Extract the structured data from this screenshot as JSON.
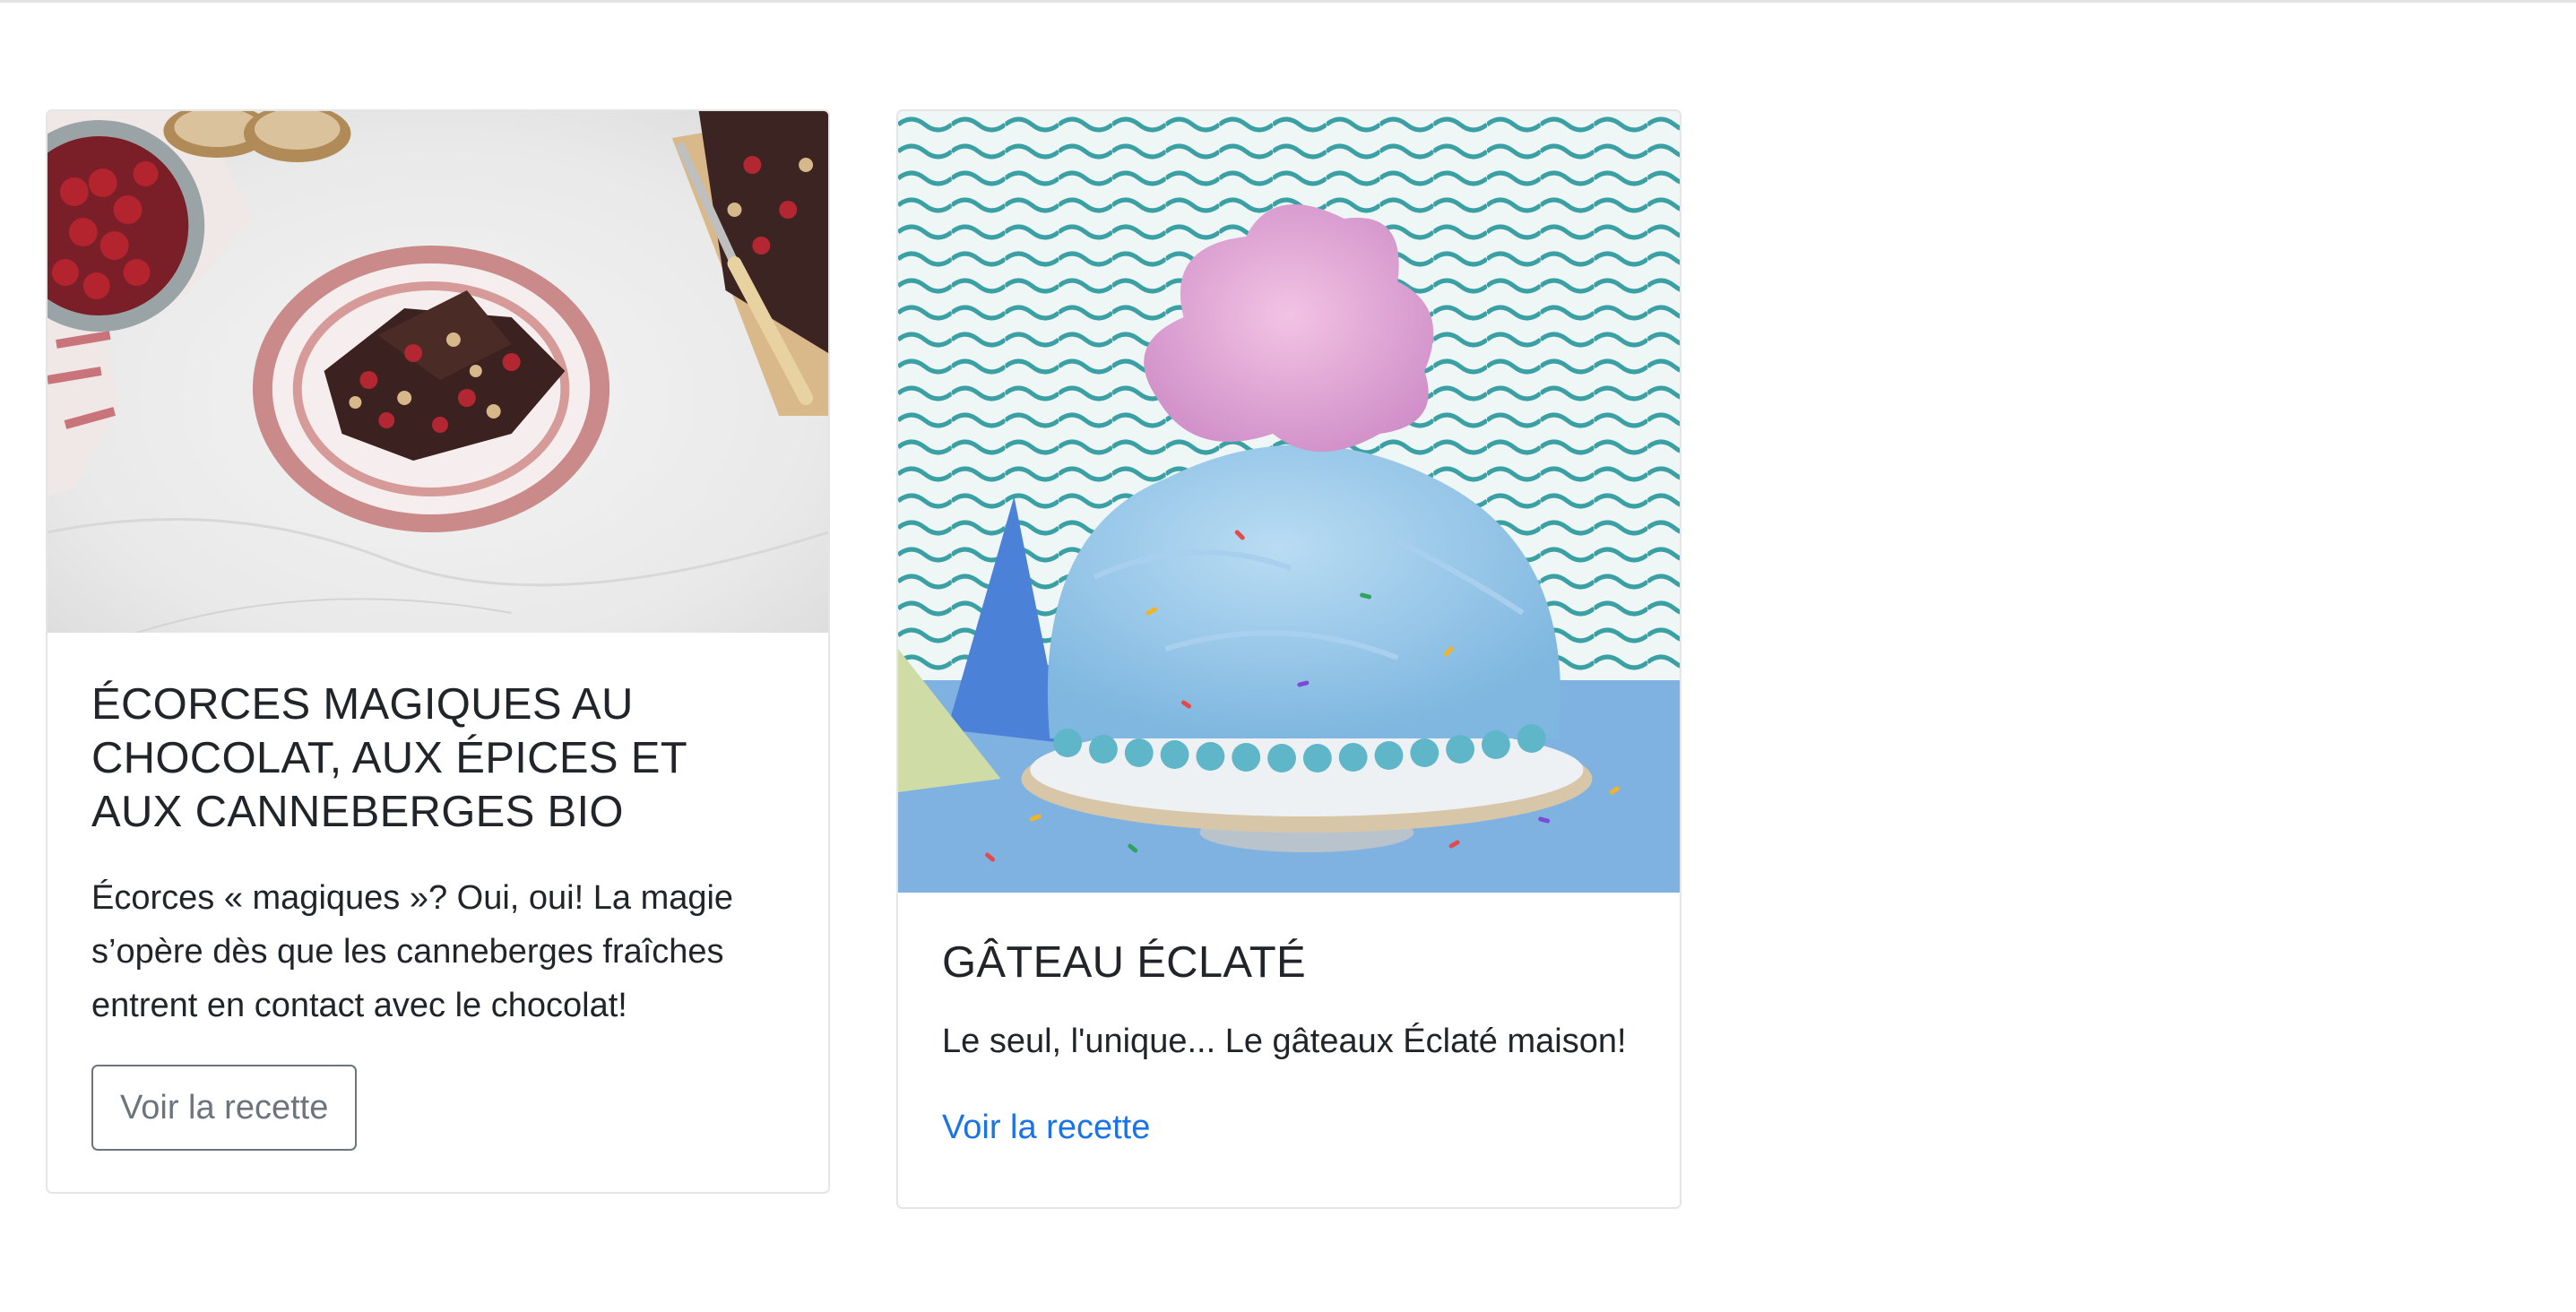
{
  "cards": [
    {
      "image_alt": "Écorces de chocolat aux canneberges dans une assiette",
      "title": "ÉCORCES MAGIQUES AU CHOCOLAT, AUX ÉPICES ET AUX CANNEBERGES BIO",
      "text": "Écorces « magiques »? Oui, oui! La magie s’opère dès que les canneberges fraîches entrent en contact avec le chocolat!",
      "cta": "Voir la recette"
    },
    {
      "image_alt": "Gâteau bleu surmonté de barbe à papa rose",
      "title": "GÂTEAU ÉCLATÉ",
      "text": "Le seul, l'unique... Le gâteaux Éclaté maison!",
      "cta": "Voir la recette"
    }
  ],
  "colors": {
    "link": "#1a73e8",
    "outline_button": "#6c757d",
    "card_border": "#e5e5e5"
  }
}
